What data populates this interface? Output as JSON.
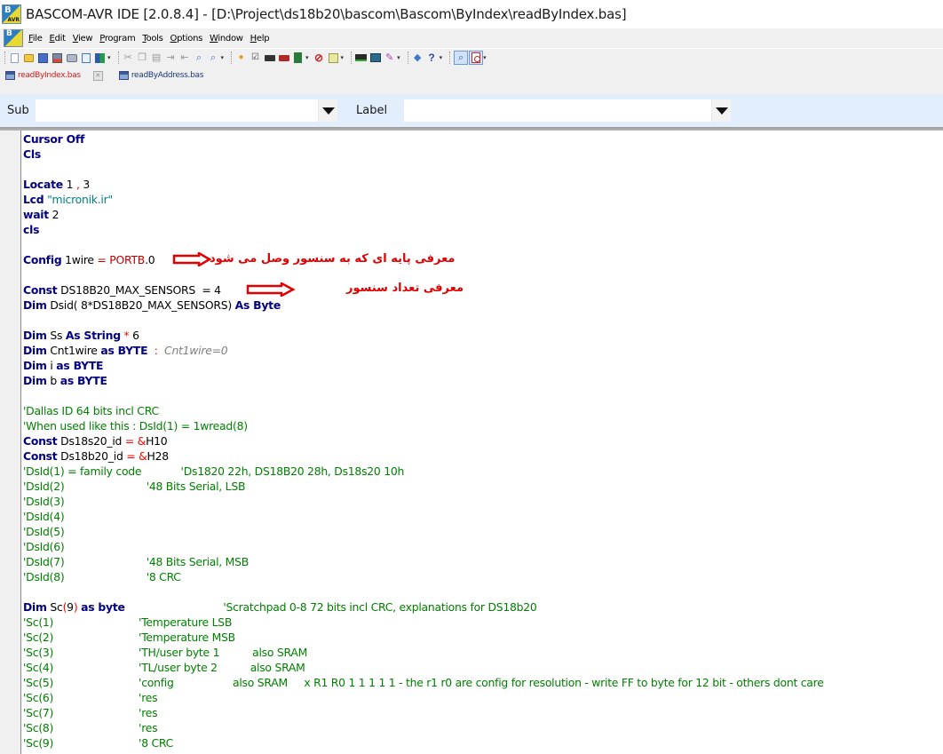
{
  "window": {
    "title": "BASCOM-AVR IDE [2.0.8.4] - [D:\\Project\\ds18b20\\bascom\\Bascom\\ByIndex\\readByIndex.bas]",
    "icon": "bascom-avr-icon"
  },
  "menu": {
    "items": [
      {
        "label": "File",
        "accel": "F"
      },
      {
        "label": "Edit",
        "accel": "E"
      },
      {
        "label": "View",
        "accel": "V"
      },
      {
        "label": "Program",
        "accel": "P"
      },
      {
        "label": "Tools",
        "accel": "T"
      },
      {
        "label": "Options",
        "accel": "O"
      },
      {
        "label": "Window",
        "accel": "W"
      },
      {
        "label": "Help",
        "accel": "H"
      }
    ]
  },
  "toolbar": {
    "groups": [
      [
        "new-file-icon",
        "open-file-icon",
        "save-icon",
        "save-as-icon",
        "print-icon",
        "print-preview-icon",
        "book-icon"
      ],
      [
        "cut-icon",
        "copy-icon",
        "paste-icon",
        "indent-icon",
        "unindent-icon",
        "find-icon",
        "find-next-icon"
      ],
      [
        "syntax-check-icon",
        "check-icon",
        "compile-icon",
        "compile-chip-icon",
        "program-chip-icon",
        "stop-icon",
        "results-icon"
      ],
      [
        "programmer-icon",
        "lcd-designer-icon",
        "simulator-icon"
      ],
      [
        "info-icon",
        "help-icon"
      ],
      [
        "zoom-icon",
        "pdf-icon"
      ]
    ]
  },
  "tabs": [
    {
      "label": "readByIndex.bas",
      "active": true
    },
    {
      "label": "readByAddress.bas",
      "active": false
    }
  ],
  "navbar": {
    "sub_label": "Sub",
    "sub_value": "",
    "label_label": "Label",
    "label_value": ""
  },
  "colors": {
    "keyword": "#000080",
    "comment": "#008000",
    "string": "#008080",
    "operator": "#ff0000",
    "annotation": "#e00000",
    "navbar_bg": "#e3eefc"
  },
  "code": {
    "lines": [
      [
        {
          "t": "kw",
          "v": "Cursor Off"
        }
      ],
      [
        {
          "t": "kw",
          "v": "Cls"
        }
      ],
      [],
      [
        {
          "t": "kw",
          "v": "Locate"
        },
        {
          "t": "tx",
          "v": " 1 "
        },
        {
          "t": "op",
          "v": ","
        },
        {
          "t": "tx",
          "v": " 3"
        }
      ],
      [
        {
          "t": "kw",
          "v": "Lcd"
        },
        {
          "t": "tx",
          "v": " "
        },
        {
          "t": "str",
          "v": "\"micronik.ir\""
        }
      ],
      [
        {
          "t": "kw",
          "v": "wait"
        },
        {
          "t": "tx",
          "v": " 2"
        }
      ],
      [
        {
          "t": "kw",
          "v": "cls"
        }
      ],
      [],
      [
        {
          "t": "kw",
          "v": "Config"
        },
        {
          "t": "tx",
          "v": " 1wire "
        },
        {
          "t": "red",
          "v": "= PORTB"
        },
        {
          "t": "tx",
          "v": ".0"
        }
      ],
      [],
      [
        {
          "t": "kw",
          "v": "Const"
        },
        {
          "t": "tx",
          "v": " DS18B20_MAX_SENSORS  = 4"
        }
      ],
      [
        {
          "t": "kw",
          "v": "Dim"
        },
        {
          "t": "tx",
          "v": " Dsid( 8*DS18B20_MAX_SENSORS) "
        },
        {
          "t": "kw",
          "v": "As Byte"
        }
      ],
      [],
      [
        {
          "t": "kw",
          "v": "Dim"
        },
        {
          "t": "tx",
          "v": " Ss "
        },
        {
          "t": "kw",
          "v": "As String"
        },
        {
          "t": "op",
          "v": " *"
        },
        {
          "t": "tx",
          "v": " 6"
        }
      ],
      [
        {
          "t": "kw",
          "v": "Dim"
        },
        {
          "t": "tx",
          "v": " Cnt1wire "
        },
        {
          "t": "kw",
          "v": "as BYTE"
        },
        {
          "t": "tx",
          "v": "  "
        },
        {
          "t": "op",
          "v": ":"
        },
        {
          "t": "tx",
          "v": "  "
        },
        {
          "t": "cmi",
          "v": "Cnt1wire=0"
        }
      ],
      [
        {
          "t": "kw",
          "v": "Dim"
        },
        {
          "t": "tx",
          "v": " i "
        },
        {
          "t": "kw",
          "v": "as BYTE"
        }
      ],
      [
        {
          "t": "kw",
          "v": "Dim"
        },
        {
          "t": "tx",
          "v": " b "
        },
        {
          "t": "kw",
          "v": "as BYTE"
        }
      ],
      [],
      [
        {
          "t": "cm",
          "v": "'Dallas ID 64 bits incl CRC"
        }
      ],
      [
        {
          "t": "cm",
          "v": "'When used like this : DsId(1) = 1wread(8)"
        }
      ],
      [
        {
          "t": "kw",
          "v": "Const"
        },
        {
          "t": "tx",
          "v": " Ds18s20_id "
        },
        {
          "t": "op",
          "v": "= &"
        },
        {
          "t": "tx",
          "v": "H10"
        }
      ],
      [
        {
          "t": "kw",
          "v": "Const"
        },
        {
          "t": "tx",
          "v": " Ds18b20_id "
        },
        {
          "t": "op",
          "v": "= &"
        },
        {
          "t": "tx",
          "v": "H28"
        }
      ],
      [
        {
          "t": "cm",
          "v": "'DsId(1) = family code            'Ds1820 22h, DS18B20 28h, Ds18s20 10h"
        }
      ],
      [
        {
          "t": "cm",
          "v": "'DsId(2)                         '48 Bits Serial, LSB"
        }
      ],
      [
        {
          "t": "cm",
          "v": "'DsId(3)"
        }
      ],
      [
        {
          "t": "cm",
          "v": "'DsId(4)"
        }
      ],
      [
        {
          "t": "cm",
          "v": "'DsId(5)"
        }
      ],
      [
        {
          "t": "cm",
          "v": "'DsId(6)"
        }
      ],
      [
        {
          "t": "cm",
          "v": "'DsId(7)                         '48 Bits Serial, MSB"
        }
      ],
      [
        {
          "t": "cm",
          "v": "'DsId(8)                         '8 CRC"
        }
      ],
      [],
      [
        {
          "t": "kw",
          "v": "Dim"
        },
        {
          "t": "tx",
          "v": " Sc"
        },
        {
          "t": "op",
          "v": "("
        },
        {
          "t": "tx",
          "v": "9"
        },
        {
          "t": "op",
          "v": ")"
        },
        {
          "t": "tx",
          "v": " "
        },
        {
          "t": "kw",
          "v": "as byte"
        },
        {
          "t": "cm",
          "v": "                              'Scratchpad 0-8 72 bits incl CRC, explanations for DS18b20"
        }
      ],
      [
        {
          "t": "cm",
          "v": "'Sc(1)                          'Temperature LSB"
        }
      ],
      [
        {
          "t": "cm",
          "v": "'Sc(2)                          'Temperature MSB"
        }
      ],
      [
        {
          "t": "cm",
          "v": "'Sc(3)                          'TH/user byte 1          also SRAM"
        }
      ],
      [
        {
          "t": "cm",
          "v": "'Sc(4)                          'TL/user byte 2          also SRAM"
        }
      ],
      [
        {
          "t": "cm",
          "v": "'Sc(5)                          'config                  also SRAM     x R1 R0 1 1 1 1 1 - the r1 r0 are config for resolution - write FF to byte for 12 bit - others dont care"
        }
      ],
      [
        {
          "t": "cm",
          "v": "'Sc(6)                          'res"
        }
      ],
      [
        {
          "t": "cm",
          "v": "'Sc(7)                          'res"
        }
      ],
      [
        {
          "t": "cm",
          "v": "'Sc(8)                          'res"
        }
      ],
      [
        {
          "t": "cm",
          "v": "'Sc(9)                          '8 CRC"
        }
      ]
    ]
  },
  "annotations": [
    {
      "text": "معرفی پایه ای که به سنسور وصل می شود",
      "line": 8
    },
    {
      "text": "معرفی تعداد سنسور",
      "line": 10
    }
  ]
}
